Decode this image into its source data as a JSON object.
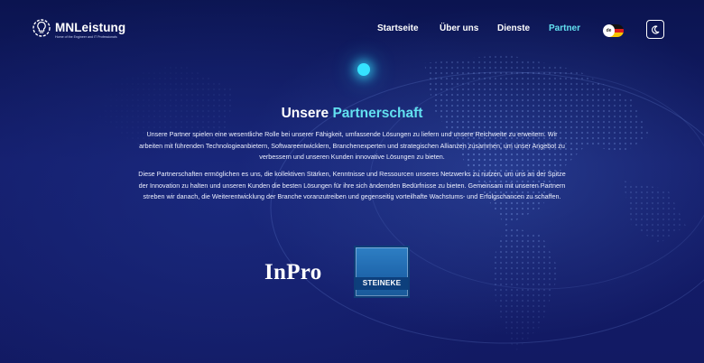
{
  "brand": {
    "name": "MNLeistung",
    "tagline": "Home of the Engineer and IT Professionals"
  },
  "nav": {
    "items": [
      {
        "label": "Startseite",
        "active": false
      },
      {
        "label": "Über uns",
        "active": false
      },
      {
        "label": "Dienste",
        "active": false
      },
      {
        "label": "Partner",
        "active": true
      }
    ],
    "language": {
      "code": "de",
      "flag_icon": "germany-flag-icon"
    },
    "theme_toggle_icon": "moon-icon"
  },
  "hero": {
    "title_prefix": "Unsere ",
    "title_accent": "Partnerschaft",
    "paragraph_1": "Unsere Partner spielen eine wesentliche Rolle bei unserer Fähigkeit, umfassende Lösungen zu liefern und unsere Reichweite zu erweitern. Wir arbeiten mit führenden Technologieanbietern, Softwareentwicklern, Branchenexperten und strategischen Allianzen zusammen, um unser Angebot zu verbessern und unseren Kunden innovative Lösungen zu bieten.",
    "paragraph_2": "Diese Partnerschaften ermöglichen es uns, die kollektiven Stärken, Kenntnisse und Ressourcen unseres Netzwerks zu nutzen, um uns an der Spitze der Innovation zu halten und unseren Kunden die besten Lösungen für ihre sich ändernden Bedürfnisse zu bieten. Gemeinsam mit unseren Partnern streben wir danach, die Weiterentwicklung der Branche voranzutreiben und gegenseitig vorteilhafte Wachstums- und Erfolgschancen zu schaffen."
  },
  "partners": [
    {
      "name": "InPro"
    },
    {
      "name": "STEINEKE"
    }
  ],
  "colors": {
    "background": "#11185a",
    "accent": "#62e0f0",
    "glow": "#35e3ff",
    "steineke_blue": "#1f67ad"
  }
}
